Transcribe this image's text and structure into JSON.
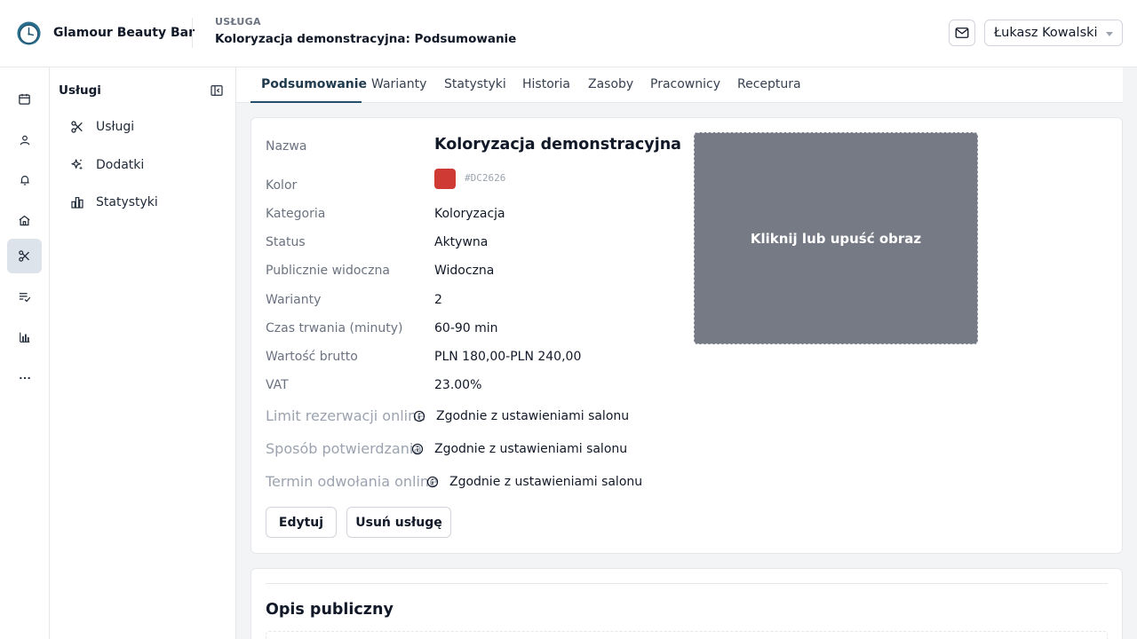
{
  "header": {
    "brand": "Glamour Beauty Bar",
    "kicker": "USŁUGA",
    "title": "Koloryzacja demonstracyjna: Podsumowanie",
    "user_name": "Łukasz Kowalski"
  },
  "rail": {
    "items": [
      {
        "icon": "calendar-icon"
      },
      {
        "icon": "user-icon"
      },
      {
        "icon": "bell-icon"
      },
      {
        "icon": "store-icon"
      },
      {
        "icon": "scissors-icon",
        "active": true
      },
      {
        "icon": "checklist-icon"
      },
      {
        "icon": "bar-chart-icon"
      },
      {
        "icon": "more-icon"
      }
    ]
  },
  "subnav": {
    "title": "Usługi",
    "items": [
      {
        "label": "Usługi",
        "icon": "scissors-icon"
      },
      {
        "label": "Dodatki",
        "icon": "sparkles-icon"
      },
      {
        "label": "Statystyki",
        "icon": "bar-chart-icon"
      }
    ]
  },
  "tabs": [
    {
      "label": "Podsumowanie",
      "active": true
    },
    {
      "label": "Warianty"
    },
    {
      "label": "Statystyki"
    },
    {
      "label": "Historia"
    },
    {
      "label": "Zasoby"
    },
    {
      "label": "Pracownicy"
    },
    {
      "label": "Receptura"
    }
  ],
  "summary": {
    "name_label": "Nazwa",
    "name_value": "Koloryzacja demonstracyjna",
    "color_label": "Kolor",
    "color_hex": "#DC2626",
    "color_swatch": "#cf3a35",
    "category_label": "Kategoria",
    "category_value": "Koloryzacja",
    "status_label": "Status",
    "status_value": "Aktywna",
    "public_label": "Publicznie widoczna",
    "public_value": "Widoczna",
    "variants_label": "Warianty",
    "variants_value": "2",
    "duration_label": "Czas trwania (minuty)",
    "duration_value": "60-90 min",
    "gross_label": "Wartość brutto",
    "gross_value": "PLN 180,00-PLN 240,00",
    "vat_label": "VAT",
    "vat_value": "23.00%",
    "limit_label": "Limit rezerwacji online",
    "limit_value": "Zgodnie z ustawieniami salonu",
    "confirm_label": "Sposób potwierdzania",
    "confirm_value": "Zgodnie z ustawieniami salonu",
    "cancel_label": "Termin odwołania online",
    "cancel_value": "Zgodnie z ustawieniami salonu",
    "image_drop_text": "Kliknij lub upuść obraz",
    "edit_button": "Edytuj",
    "delete_button": "Usuń usługę"
  },
  "description": {
    "title": "Opis publiczny"
  },
  "colors": {
    "accent": "#24506b",
    "rail_active_bg": "#dde3ea",
    "image_placeholder_bg": "#767a84"
  }
}
